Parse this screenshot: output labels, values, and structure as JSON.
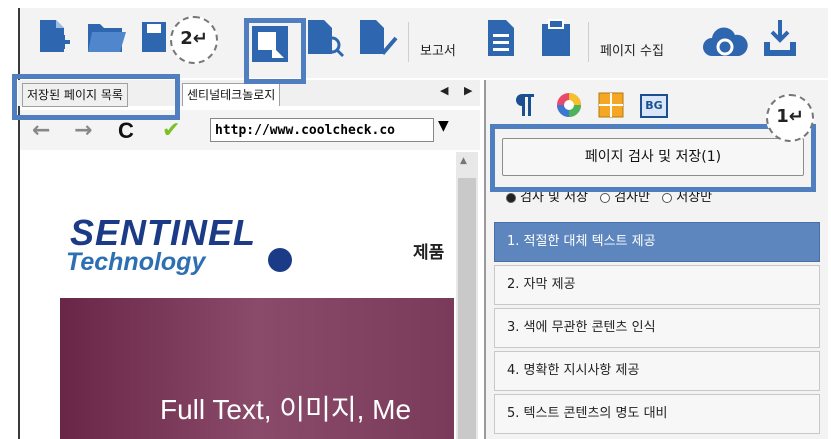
{
  "toolbar": {
    "report_label": "보고서",
    "page_collect_label": "페이지 수집"
  },
  "tabs": {
    "saved_pages": "저장된 페이지 목록",
    "sentinel": "센티널테크놀로지",
    "scroll_arrows": "◀ ▶"
  },
  "browser": {
    "back": "←",
    "forward": "→",
    "refresh": "C",
    "check": "✔",
    "url": "http://www.coolcheck.co",
    "dropdown": "▼"
  },
  "website": {
    "logo_top": "SENTINEL",
    "logo_bottom": "Technology",
    "menu_partial": "제품",
    "hero_text": "Full Text, 이미지, Me"
  },
  "right_panel": {
    "check_save_button": "페이지 검사 및 저장(1)",
    "radio_options": [
      "검사 및 저장",
      "검사만",
      "저장만"
    ],
    "checklist": [
      "1. 적절한 대체 텍스트 제공",
      "2. 자막 제공",
      "3. 색에 무관한 콘텐츠 인식",
      "4. 명확한 지시사항 제공",
      "5. 텍스트 콘텐츠의 명도 대비"
    ],
    "bg_icon_label": "BG"
  },
  "callouts": {
    "one": "1↵",
    "two": "2↵"
  },
  "colors": {
    "highlight": "#4f7fbf",
    "selected_item": "#5d86be",
    "logo_navy": "#1c3b86",
    "hero": "#6a2647"
  }
}
